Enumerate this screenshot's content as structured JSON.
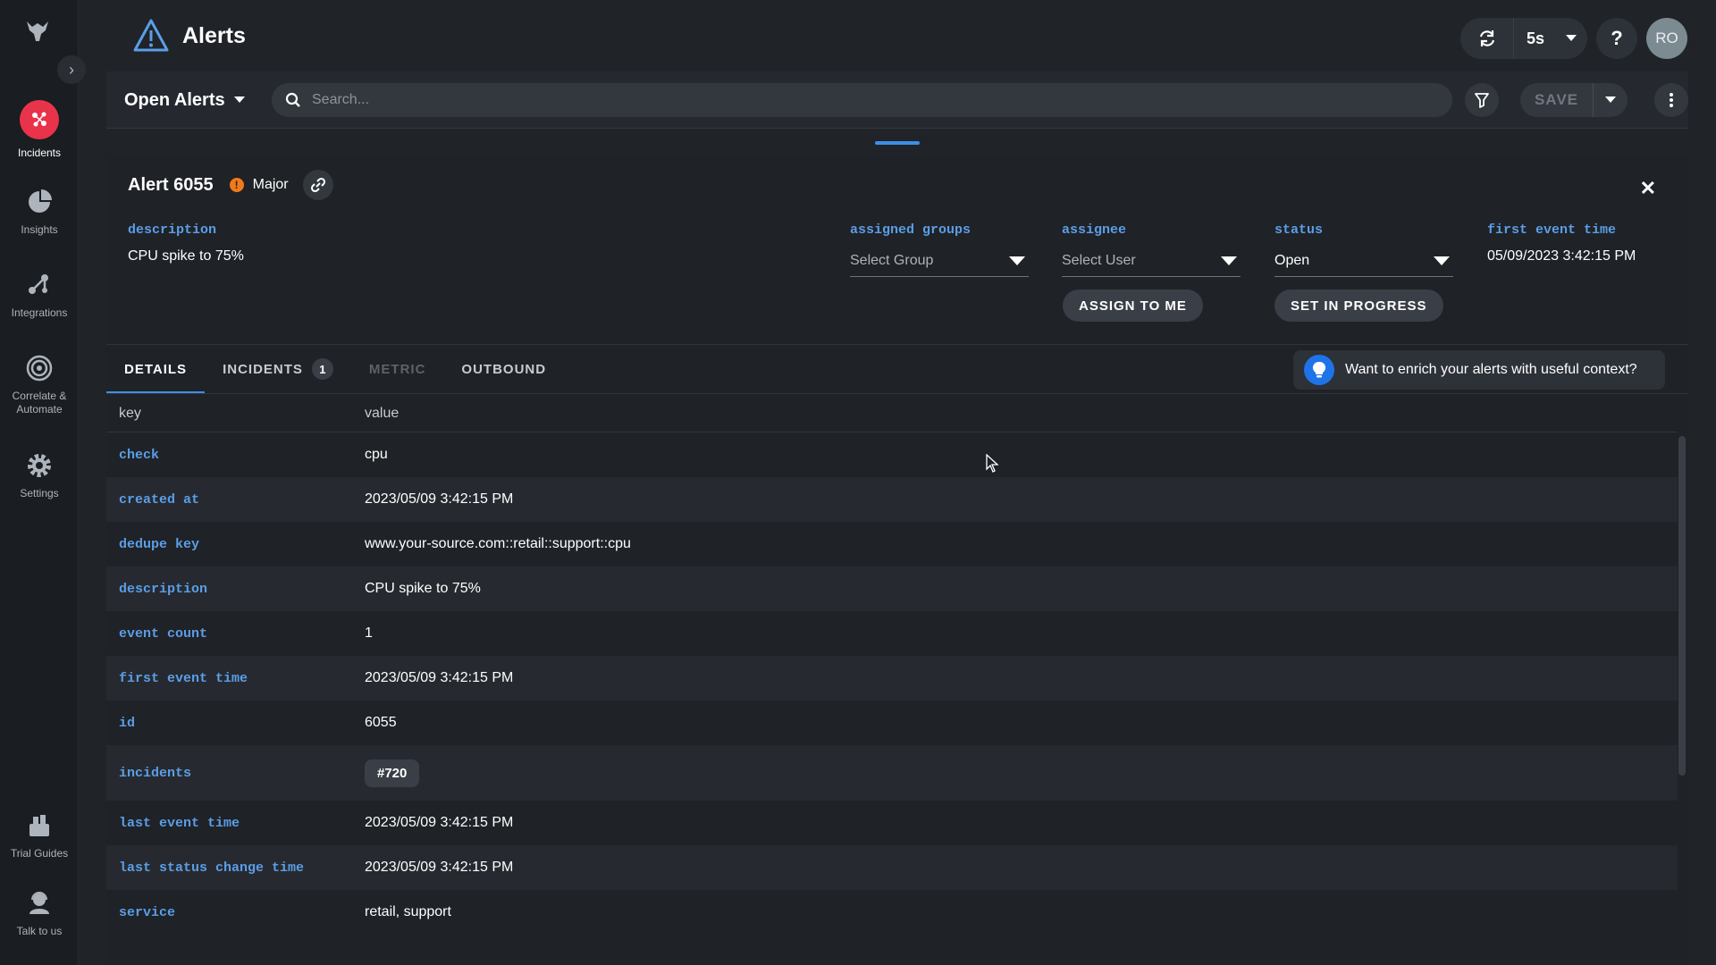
{
  "sidebar": {
    "items": [
      {
        "label": "Incidents",
        "icon": "incidents-icon",
        "active": true
      },
      {
        "label": "Insights",
        "icon": "pie-chart-icon"
      },
      {
        "label": "Integrations",
        "icon": "integrations-icon"
      },
      {
        "label": "Correlate & Automate",
        "icon": "target-icon"
      },
      {
        "label": "Settings",
        "icon": "gear-icon"
      },
      {
        "label": "Trial Guides",
        "icon": "book-icon"
      },
      {
        "label": "Talk to us",
        "icon": "support-agent-icon"
      }
    ],
    "active_color": "#e8334a"
  },
  "header": {
    "title": "Alerts",
    "refresh_interval": "5s",
    "help_label": "?",
    "avatar_initials": "RO"
  },
  "toolbar": {
    "view_label": "Open Alerts",
    "search_placeholder": "Search...",
    "save_label": "SAVE"
  },
  "alert": {
    "title": "Alert 6055",
    "severity": "Major",
    "severity_color": "#f07a1a",
    "description_label": "description",
    "description_value": "CPU spike to 75%",
    "assigned_groups_label": "assigned groups",
    "assigned_groups_placeholder": "Select Group",
    "assignee_label": "assignee",
    "assignee_placeholder": "Select User",
    "assign_to_me_label": "ASSIGN TO ME",
    "status_label": "status",
    "status_value": "Open",
    "set_in_progress_label": "SET IN PROGRESS",
    "first_event_time_label": "first event time",
    "first_event_time_value": "05/09/2023 3:42:15 PM"
  },
  "tabs": [
    {
      "label": "DETAILS",
      "active": true
    },
    {
      "label": "INCIDENTS",
      "count": "1"
    },
    {
      "label": "METRIC",
      "disabled": true
    },
    {
      "label": "OUTBOUND"
    }
  ],
  "enrich_banner": "Want to enrich your alerts with useful context?",
  "table": {
    "headers": [
      "key",
      "value"
    ],
    "rows": [
      {
        "key": "check",
        "value": "cpu"
      },
      {
        "key": "created at",
        "value": "2023/05/09 3:42:15 PM"
      },
      {
        "key": "dedupe key",
        "value": "www.your-source.com::retail::support::cpu"
      },
      {
        "key": "description",
        "value": "CPU spike to 75%"
      },
      {
        "key": "event count",
        "value": "1"
      },
      {
        "key": "first event time",
        "value": "2023/05/09 3:42:15 PM"
      },
      {
        "key": "id",
        "value": "6055"
      },
      {
        "key": "incidents",
        "value": "#720"
      },
      {
        "key": "last event time",
        "value": "2023/05/09 3:42:15 PM"
      },
      {
        "key": "last status change time",
        "value": "2023/05/09 3:42:15 PM"
      },
      {
        "key": "service",
        "value": "retail, support"
      }
    ]
  }
}
